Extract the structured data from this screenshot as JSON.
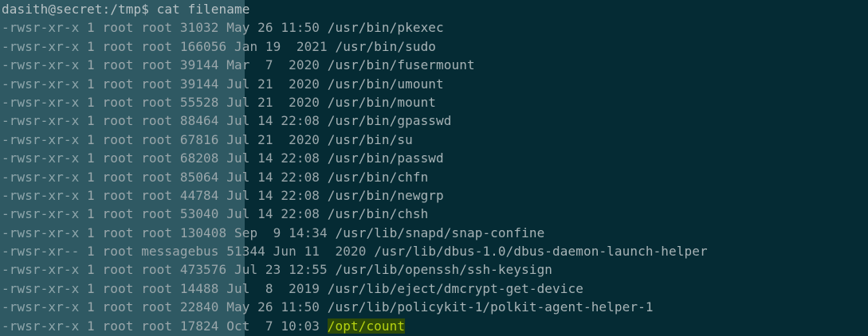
{
  "terminal": {
    "prompt": "dasith@secret:/tmp$ cat filename",
    "rows": [
      {
        "perm": "-rwsr-xr-x",
        "rest": " 1 root root 31032 May 26 11:50 ",
        "path": "/usr/bin/pkexec"
      },
      {
        "perm": "-rwsr-xr-x",
        "rest": " 1 root root 166056 Jan 19  2021 ",
        "path": "/usr/bin/sudo"
      },
      {
        "perm": "-rwsr-xr-x",
        "rest": " 1 root root 39144 Mar  7  2020 ",
        "path": "/usr/bin/fusermount"
      },
      {
        "perm": "-rwsr-xr-x",
        "rest": " 1 root root 39144 Jul 21  2020 ",
        "path": "/usr/bin/umount"
      },
      {
        "perm": "-rwsr-xr-x",
        "rest": " 1 root root 55528 Jul 21  2020 ",
        "path": "/usr/bin/mount"
      },
      {
        "perm": "-rwsr-xr-x",
        "rest": " 1 root root 88464 Jul 14 22:08 ",
        "path": "/usr/bin/gpasswd"
      },
      {
        "perm": "-rwsr-xr-x",
        "rest": " 1 root root 67816 Jul 21  2020 ",
        "path": "/usr/bin/su"
      },
      {
        "perm": "-rwsr-xr-x",
        "rest": " 1 root root 68208 Jul 14 22:08 ",
        "path": "/usr/bin/passwd"
      },
      {
        "perm": "-rwsr-xr-x",
        "rest": " 1 root root 85064 Jul 14 22:08 ",
        "path": "/usr/bin/chfn"
      },
      {
        "perm": "-rwsr-xr-x",
        "rest": " 1 root root 44784 Jul 14 22:08 ",
        "path": "/usr/bin/newgrp"
      },
      {
        "perm": "-rwsr-xr-x",
        "rest": " 1 root root 53040 Jul 14 22:08 ",
        "path": "/usr/bin/chsh"
      },
      {
        "perm": "-rwsr-xr-x",
        "rest": " 1 root root 130408 Sep  9 14:34 ",
        "path": "/usr/lib/snapd/snap-confine"
      },
      {
        "perm": "-rwsr-xr--",
        "rest": " 1 root messagebus 51344 Jun 11  2020 ",
        "path": "/usr/lib/dbus-1.0/dbus-daemon-launch-helper"
      },
      {
        "perm": "-rwsr-xr-x",
        "rest": " 1 root root 473576 Jul 23 12:55 ",
        "path": "/usr/lib/openssh/ssh-keysign"
      },
      {
        "perm": "-rwsr-xr-x",
        "rest": " 1 root root 14488 Jul  8  2019 ",
        "path": "/usr/lib/eject/dmcrypt-get-device"
      },
      {
        "perm": "-rwsr-xr-x",
        "rest": " 1 root root 22840 May 26 11:50 ",
        "path": "/usr/lib/policykit-1/polkit-agent-helper-1"
      },
      {
        "perm": "-rwsr-xr-x",
        "rest": " 1 root root 17824 Oct  7 10:03 ",
        "path": "/opt/count",
        "highlight": true
      }
    ]
  },
  "colors": {
    "background": "#052b34",
    "selection_shade": "#2f5963",
    "text": "#9aa7ab",
    "highlight_bg": "#2e4a07",
    "highlight_fg": "#b7d311"
  }
}
